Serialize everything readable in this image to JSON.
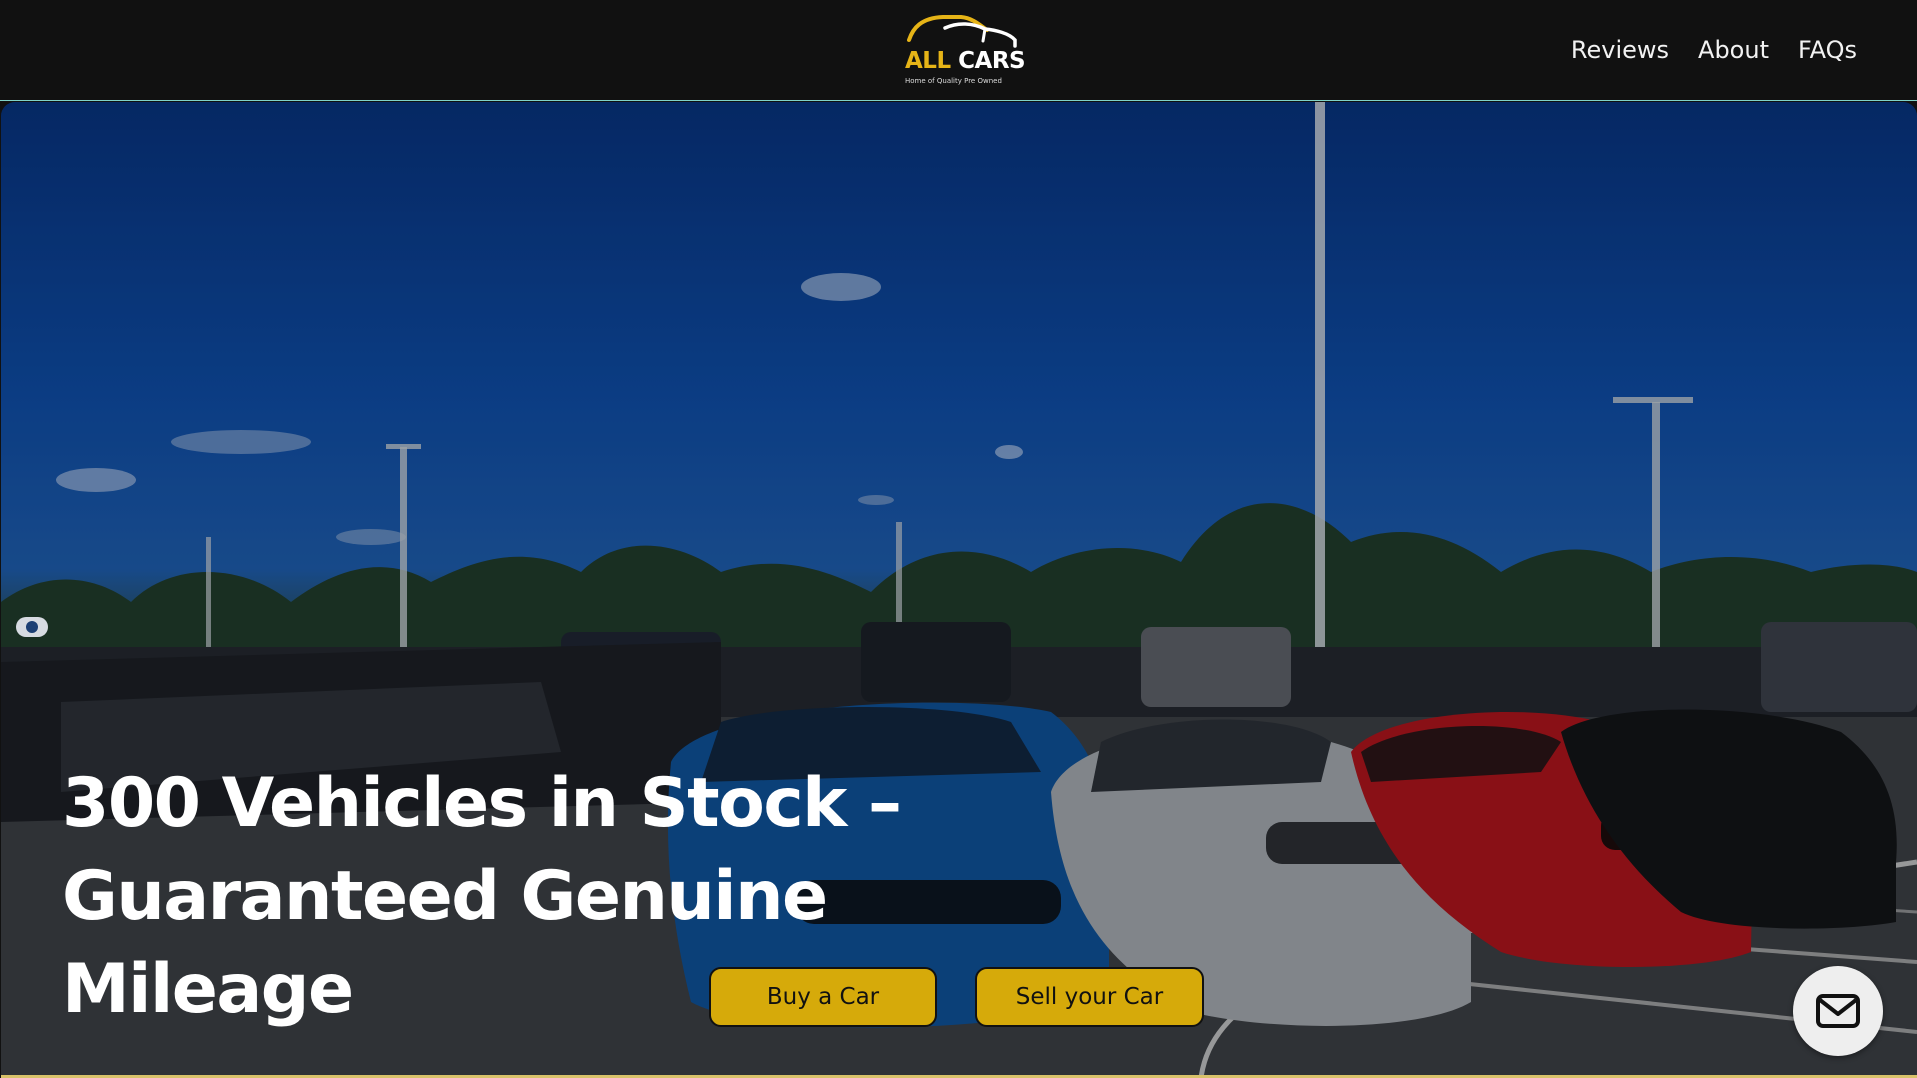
{
  "header": {
    "logo": {
      "word_primary": "ALL",
      "word_secondary": "CARS",
      "tagline": "Home of Quality Pre Owned"
    },
    "nav": [
      {
        "label": "Reviews"
      },
      {
        "label": "About"
      },
      {
        "label": "FAQs"
      }
    ]
  },
  "hero": {
    "title": "300 Vehicles in Stock – Guaranteed Genuine Mileage",
    "buttons": {
      "buy_label": "Buy a Car",
      "sell_label": "Sell your Car"
    }
  },
  "floating": {
    "contact_icon": "mail-icon"
  },
  "colors": {
    "header_bg": "#111111",
    "accent_yellow": "#d6aa0a",
    "hero_text": "#ffffff"
  }
}
